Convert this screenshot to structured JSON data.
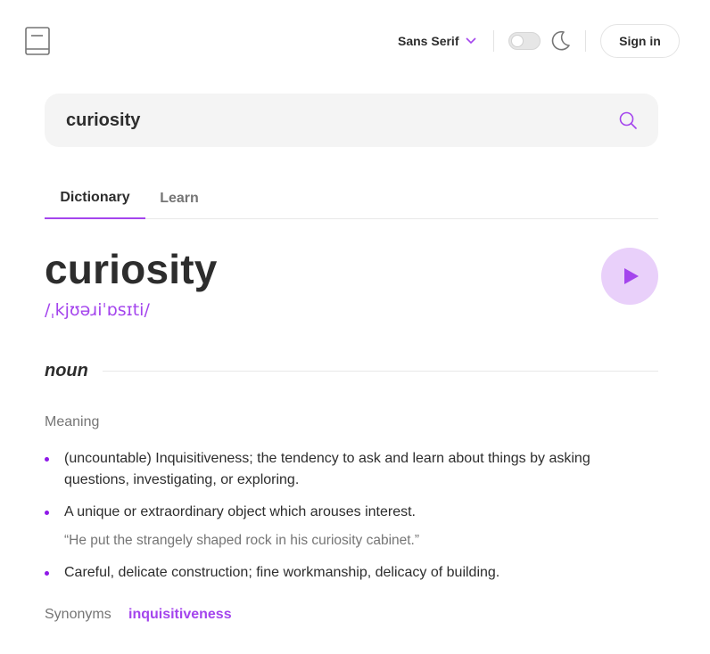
{
  "header": {
    "font_selector": {
      "value": "Sans Serif"
    },
    "theme_toggle": {
      "state": "off",
      "icon": "moon-icon"
    },
    "sign_in_label": "Sign in"
  },
  "search": {
    "value": "curiosity"
  },
  "tabs": [
    {
      "label": "Dictionary",
      "active": true
    },
    {
      "label": "Learn",
      "active": false
    }
  ],
  "entry": {
    "word": "curiosity",
    "phonetic": "/ˌkjʊəɹiˈɒsɪti/",
    "part_of_speech": "noun",
    "meaning_label": "Meaning",
    "definitions": [
      {
        "line1": "(uncountable) Inquisitiveness; the tendency to ask and learn about things by asking",
        "line2": "questions, investigating, or exploring."
      },
      {
        "line1": "A unique or extraordinary object which arouses interest.",
        "example": "“He put the strangely shaped rock in his curiosity cabinet.”"
      },
      {
        "line1": "Careful, delicate construction; fine workmanship, delicacy of building."
      }
    ],
    "synonyms_label": "Synonyms",
    "synonyms": [
      "inquisitiveness"
    ]
  },
  "colors": {
    "accent": "#a445ed",
    "play_bg": "#e9d0fa",
    "text": "#2d2d2d",
    "muted": "#757575"
  }
}
